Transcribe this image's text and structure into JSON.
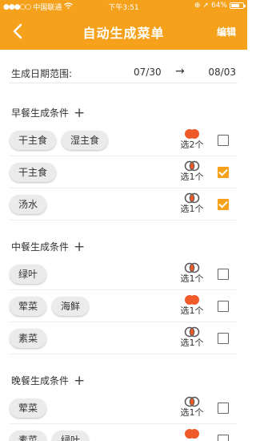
{
  "status_bar": {
    "carrier": "中国联通",
    "time": "下午3:51",
    "battery": "64%",
    "battery_level": 0.64
  },
  "nav": {
    "title": "自动生成菜单",
    "edit_label": "编辑"
  },
  "date_range": {
    "label": "生成日期范围:",
    "start": "07/30",
    "end": "08/03",
    "arrow": "→"
  },
  "colors": {
    "accent": "#f5a11c",
    "rule_red": "#f05a28",
    "rule_outline": "#555555"
  },
  "sections": [
    {
      "title": "早餐生成条件",
      "plus": "+",
      "rows": [
        {
          "chips": [
            "干主食",
            "湿主食"
          ],
          "rule": "选2个",
          "icon": "filled-overlap-icon",
          "checked": false
        },
        {
          "chips": [
            "干主食"
          ],
          "rule": "选1个",
          "icon": "outline-overlap-icon",
          "checked": true
        },
        {
          "chips": [
            "汤水"
          ],
          "rule": "选1个",
          "icon": "outline-overlap-icon",
          "checked": true
        }
      ]
    },
    {
      "title": "中餐生成条件",
      "plus": "+",
      "rows": [
        {
          "chips": [
            "绿叶"
          ],
          "rule": "选1个",
          "icon": "outline-overlap-icon",
          "checked": false
        },
        {
          "chips": [
            "荤菜",
            "海鲜"
          ],
          "rule": "选1个",
          "icon": "filled-overlap-icon",
          "checked": false
        },
        {
          "chips": [
            "素菜"
          ],
          "rule": "选1个",
          "icon": "outline-overlap-icon",
          "checked": false
        }
      ]
    },
    {
      "title": "晚餐生成条件",
      "plus": "+",
      "rows": [
        {
          "chips": [
            "荤菜"
          ],
          "rule": "选1个",
          "icon": "outline-overlap-icon",
          "checked": false
        },
        {
          "chips": [
            "素菜",
            "绿叶"
          ],
          "rule": "",
          "icon": "filled-overlap-icon",
          "checked": false
        }
      ]
    }
  ]
}
